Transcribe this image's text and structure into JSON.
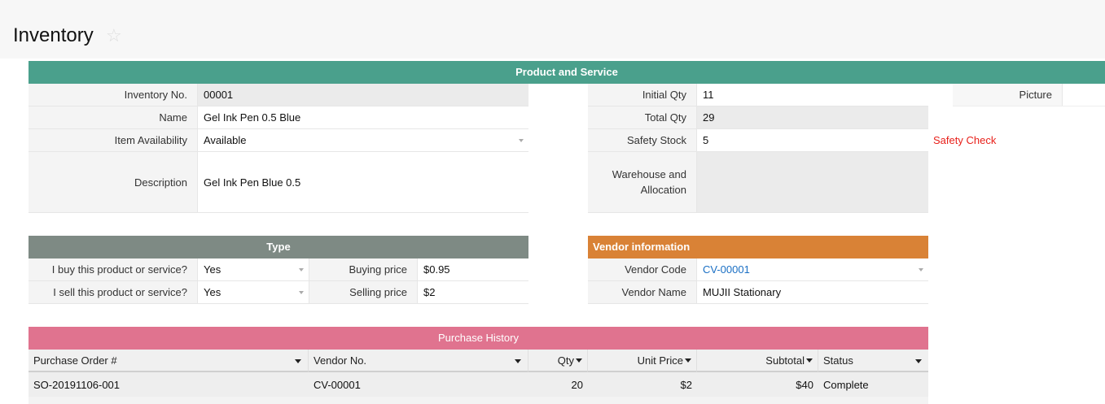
{
  "page": {
    "title": "Inventory"
  },
  "colors": {
    "product_band": "#4aa08c",
    "type_band": "#7e8a84",
    "vendor_band": "#d98236",
    "history_band": "#e0738f",
    "link": "#1a6fc4",
    "warning": "#e8201a"
  },
  "product": {
    "header": "Product and Service",
    "inventory_no_label": "Inventory No.",
    "inventory_no": "00001",
    "name_label": "Name",
    "name": "Gel Ink Pen 0.5 Blue",
    "availability_label": "Item Availability",
    "availability": "Available",
    "description_label": "Description",
    "description": "Gel Ink Pen Blue 0.5",
    "initial_qty_label": "Initial Qty",
    "initial_qty": "11",
    "total_qty_label": "Total Qty",
    "total_qty": "29",
    "safety_stock_label": "Safety Stock",
    "safety_stock": "5",
    "safety_check": "Safety Check",
    "warehouse_label_1": "Warehouse and",
    "warehouse_label_2": "Allocation",
    "picture_label": "Picture"
  },
  "type": {
    "header": "Type",
    "buy_label": "I buy this product or service?",
    "buy_value": "Yes",
    "sell_label": "I sell this product or service?",
    "sell_value": "Yes",
    "buying_price_label": "Buying price",
    "buying_price": "$0.95",
    "selling_price_label": "Selling price",
    "selling_price": "$2"
  },
  "vendor": {
    "header": "Vendor information",
    "code_label": "Vendor Code",
    "code": "CV-00001",
    "name_label": "Vendor Name",
    "name": "MUJII Stationary"
  },
  "history": {
    "header": "Purchase History",
    "columns": [
      "Purchase Order #",
      "Vendor No.",
      "Qty",
      "Unit Price",
      "Subtotal",
      "Status"
    ],
    "rows": [
      {
        "po": "SO-20191106-001",
        "vendor": "CV-00001",
        "qty": "20",
        "unit_price": "$2",
        "subtotal": "$40",
        "status": "Complete"
      }
    ]
  }
}
